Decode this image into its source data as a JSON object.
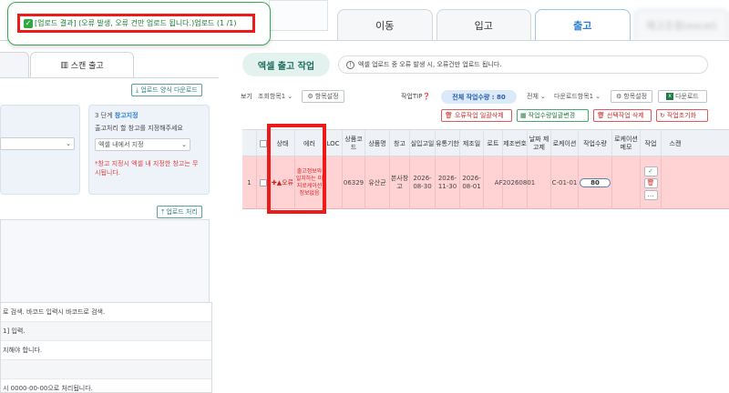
{
  "top_tabs": [
    {
      "label": "이동",
      "active": false
    },
    {
      "label": "입고",
      "active": false
    },
    {
      "label": "출고",
      "active": true
    },
    {
      "label": "재고조정(excel)",
      "active": false
    }
  ],
  "toast": {
    "message": "[업로드 결과] (오류 발생, 오류 건만 업로드 됩니다.)업로드 (1 /1)",
    "border_color": "#3aa757"
  },
  "left_panel": {
    "sub_tabs": [
      "",
      "스캔 출고"
    ],
    "download_form_label": "업로드 양식 다운로드",
    "step3": {
      "title_prefix": "3 단계",
      "title_highlight": "창고지정",
      "desc": "출고처리 할 창고를 지정해주세요",
      "select_value": "엑셀 내에서 지정",
      "warning": "*창고 지정시 엑셀 내 지정한 창고는 무시됩니다."
    },
    "upload_process_label": "업로드 처리",
    "info_lines": [
      "로 검색. 바코드 입력시 바코드로 검색.",
      "1] 입력.",
      "지해야 합니다.",
      "",
      "시 0000-00-00으로 처리됩니다."
    ]
  },
  "work": {
    "title": "엑셀 출고 작업",
    "info": "엑셀 업로드 중 오류 발생 시, 오류건만 업로드 됩니다."
  },
  "toolbar": {
    "view_label": "보기",
    "view_select": "조회항목1",
    "item_setting": "항목설정",
    "work_tip": "작업TIP",
    "total_label": "전체 작업수량 : 80",
    "all_select": "전체",
    "download_select": "다운로드항목1",
    "item_setting2": "항목설정",
    "download": "다운로드",
    "delete_errors": "오류작업 일괄삭제",
    "bulk_qty_change": "작업수량일괄변경",
    "delete_selected": "선택작업 삭제",
    "reset_work": "작업초기화"
  },
  "table": {
    "headers": [
      "",
      "상태",
      "에러",
      "LOC",
      "상품코드",
      "상품명",
      "창고",
      "실입고일",
      "유통기한",
      "제조일",
      "로트",
      "제조번호",
      "날짜 제고제",
      "로케이션",
      "작업수량",
      "로케이션메모",
      "작업",
      "스캔"
    ],
    "row": {
      "index": "1",
      "status": "✚▲오류",
      "error": "출고정보와 일치하는 미지로케이션 정보없음",
      "loc": "",
      "product_code": "06329",
      "product_name": "유산균",
      "warehouse": "본사창고",
      "in_date": "2026-08-30",
      "expiry": "2026-11-30",
      "mfg_date": "2026-08-01",
      "lot": "",
      "mfg_no": "AF20260801",
      "date_extra": "",
      "location": "C-01-01",
      "qty": "80",
      "loc_memo": ""
    }
  },
  "colors": {
    "error_row": "#ffd3d3",
    "highlight": "#ee1a1a",
    "accent": "#2a7fd4"
  }
}
